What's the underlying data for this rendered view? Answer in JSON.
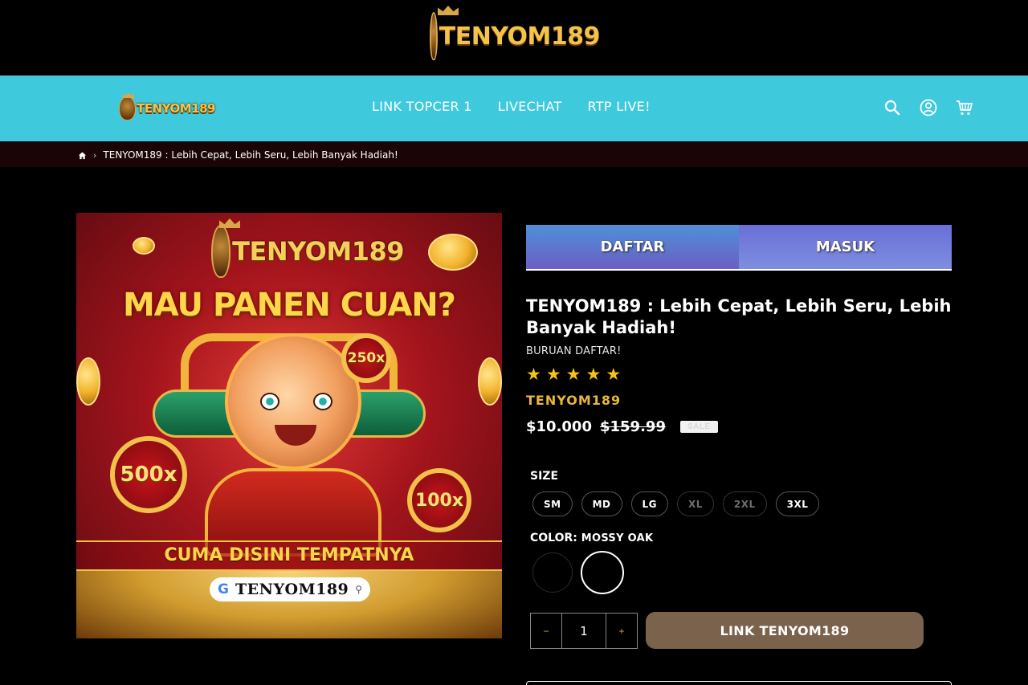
{
  "site": {
    "logo_text": "TENYOM189"
  },
  "nav": {
    "links": [
      "LINK TOPCER 1",
      "LIVECHAT",
      "RTP LIVE!"
    ],
    "icons": [
      "search-icon",
      "account-icon",
      "cart-icon"
    ]
  },
  "breadcrumb": {
    "home_icon": "home-icon",
    "separator": "›",
    "current": "TENYOM189 : Lebih Cepat, Lebih Seru, Lebih Banyak Hadiah!"
  },
  "banner": {
    "logo_text": "TENYOM189",
    "headline": "MAU PANEN CUAN?",
    "multipliers": [
      "500x",
      "250x",
      "100x"
    ],
    "tagline": "CUMA DISINI TEMPATNYA",
    "search_g": "G",
    "search_text": "TENYOM189"
  },
  "auth": {
    "register_label": "DAFTAR",
    "login_label": "MASUK"
  },
  "product": {
    "title": "TENYOM189 : Lebih Cepat, Lebih Seru, Lebih Banyak Hadiah!",
    "subtitle": "BURUAN DAFTAR!",
    "rating_stars": 5,
    "vendor": "TENYOM189",
    "price": "$10.000",
    "compare_price": "$159.99",
    "sale_badge": "SALE"
  },
  "options": {
    "size_label": "SIZE",
    "sizes": [
      {
        "label": "SM",
        "available": true
      },
      {
        "label": "MD",
        "available": true
      },
      {
        "label": "LG",
        "available": true
      },
      {
        "label": "XL",
        "available": false
      },
      {
        "label": "2XL",
        "available": false
      },
      {
        "label": "3XL",
        "available": true
      }
    ],
    "color_label": "COLOR:",
    "color_value": "MOSSY OAK",
    "swatch_colors": [
      "#000000",
      "#000000"
    ]
  },
  "cart": {
    "minus": "−",
    "quantity": "1",
    "plus": "+",
    "cta_label": "LINK TENYOM189"
  },
  "colors": {
    "nav_bg": "#3ec9dc",
    "accent_gold": "#e7b73c",
    "cta_bg": "#7a624c"
  }
}
